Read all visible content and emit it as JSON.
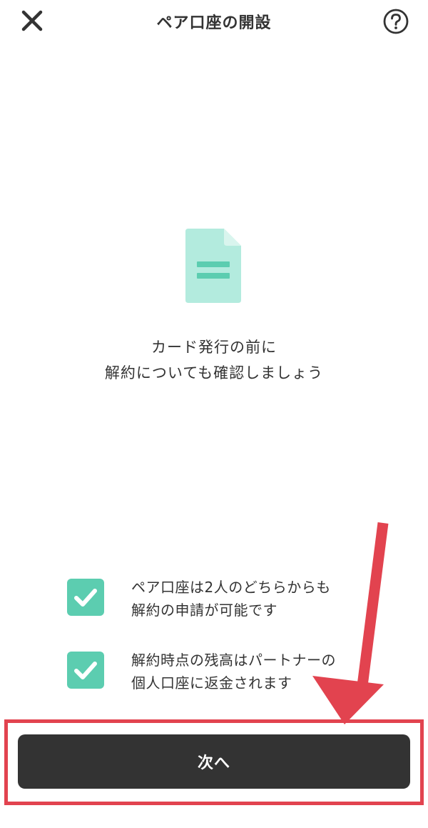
{
  "header": {
    "title": "ペア口座の開設",
    "close_icon": "close-icon",
    "help_icon": "help-icon"
  },
  "illustration": {
    "icon": "document-icon",
    "colors": {
      "page": "#b3ebde",
      "fold": "#d9f5ee",
      "lines": "#5ccdb0"
    }
  },
  "intro": {
    "line1": "カード発行の前に",
    "line2": "解約についても確認しましょう"
  },
  "checklist": [
    {
      "checked": true,
      "line1": "ペア口座は2人のどちらからも",
      "line2": "解約の申請が可能です"
    },
    {
      "checked": true,
      "line1": "解約時点の残高はパートナーの",
      "line2": "個人口座に返金されます"
    }
  ],
  "next_button": {
    "label": "次へ"
  },
  "colors": {
    "accent": "#5ccdb0",
    "button": "#333333",
    "annotation": "#e2434f"
  }
}
